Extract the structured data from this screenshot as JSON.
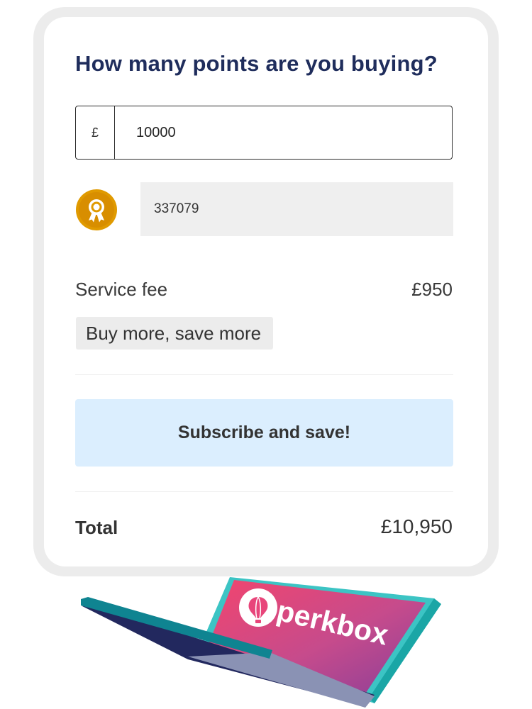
{
  "form": {
    "question": "How many points are you buying?",
    "currency_symbol": "£",
    "amount_value": "10000",
    "points_value": "337079",
    "points_icon": "award-rosette-icon"
  },
  "summary": {
    "service_fee_label": "Service fee",
    "service_fee_value": "£950",
    "promo_tag": "Buy more, save more",
    "subscribe_label": "Subscribe and save!",
    "total_label": "Total",
    "total_value": "£10,950"
  },
  "illustration": {
    "brand": "perkbox",
    "logo_icon": "hot-air-balloon-icon"
  },
  "colors": {
    "heading": "#1f2d5c",
    "subscribe_bg": "#dbeefe",
    "badge_gold": "#e09a00",
    "brand_pink": "#f2456e",
    "brand_purple": "#8a3f98",
    "teal": "#1aa6a6",
    "navy": "#22285e"
  }
}
